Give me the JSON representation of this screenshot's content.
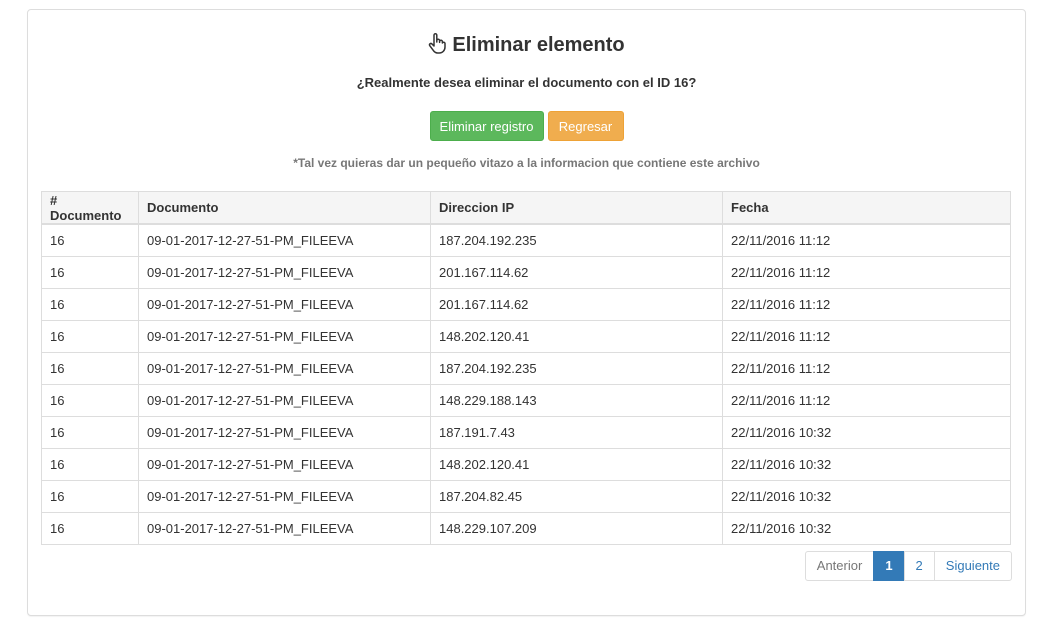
{
  "header": {
    "title": "Eliminar elemento",
    "icon": "hand-pointer-icon",
    "question": "¿Realmente desea eliminar el documento con el ID 16?"
  },
  "actions": {
    "delete_label": "Eliminar registro",
    "back_label": "Regresar"
  },
  "note": "*Tal vez quieras dar un pequeño vitazo a la informacion que contiene este archivo",
  "table": {
    "columns": [
      "# Documento",
      "Documento",
      "Direccion IP",
      "Fecha"
    ],
    "rows": [
      [
        "16",
        "09-01-2017-12-27-51-PM_FILEEVA",
        "187.204.192.235",
        "22/11/2016 11:12"
      ],
      [
        "16",
        "09-01-2017-12-27-51-PM_FILEEVA",
        "201.167.114.62",
        "22/11/2016 11:12"
      ],
      [
        "16",
        "09-01-2017-12-27-51-PM_FILEEVA",
        "201.167.114.62",
        "22/11/2016 11:12"
      ],
      [
        "16",
        "09-01-2017-12-27-51-PM_FILEEVA",
        "148.202.120.41",
        "22/11/2016 11:12"
      ],
      [
        "16",
        "09-01-2017-12-27-51-PM_FILEEVA",
        "187.204.192.235",
        "22/11/2016 11:12"
      ],
      [
        "16",
        "09-01-2017-12-27-51-PM_FILEEVA",
        "148.229.188.143",
        "22/11/2016 11:12"
      ],
      [
        "16",
        "09-01-2017-12-27-51-PM_FILEEVA",
        "187.191.7.43",
        "22/11/2016 10:32"
      ],
      [
        "16",
        "09-01-2017-12-27-51-PM_FILEEVA",
        "148.202.120.41",
        "22/11/2016 10:32"
      ],
      [
        "16",
        "09-01-2017-12-27-51-PM_FILEEVA",
        "187.204.82.45",
        "22/11/2016 10:32"
      ],
      [
        "16",
        "09-01-2017-12-27-51-PM_FILEEVA",
        "148.229.107.209",
        "22/11/2016 10:32"
      ]
    ]
  },
  "pagination": {
    "prev_label": "Anterior",
    "pages": [
      "1",
      "2"
    ],
    "active_page": "1",
    "next_label": "Siguiente"
  },
  "colors": {
    "success": "#5cb85c",
    "warning": "#f0ad4e",
    "primary": "#337ab7"
  }
}
